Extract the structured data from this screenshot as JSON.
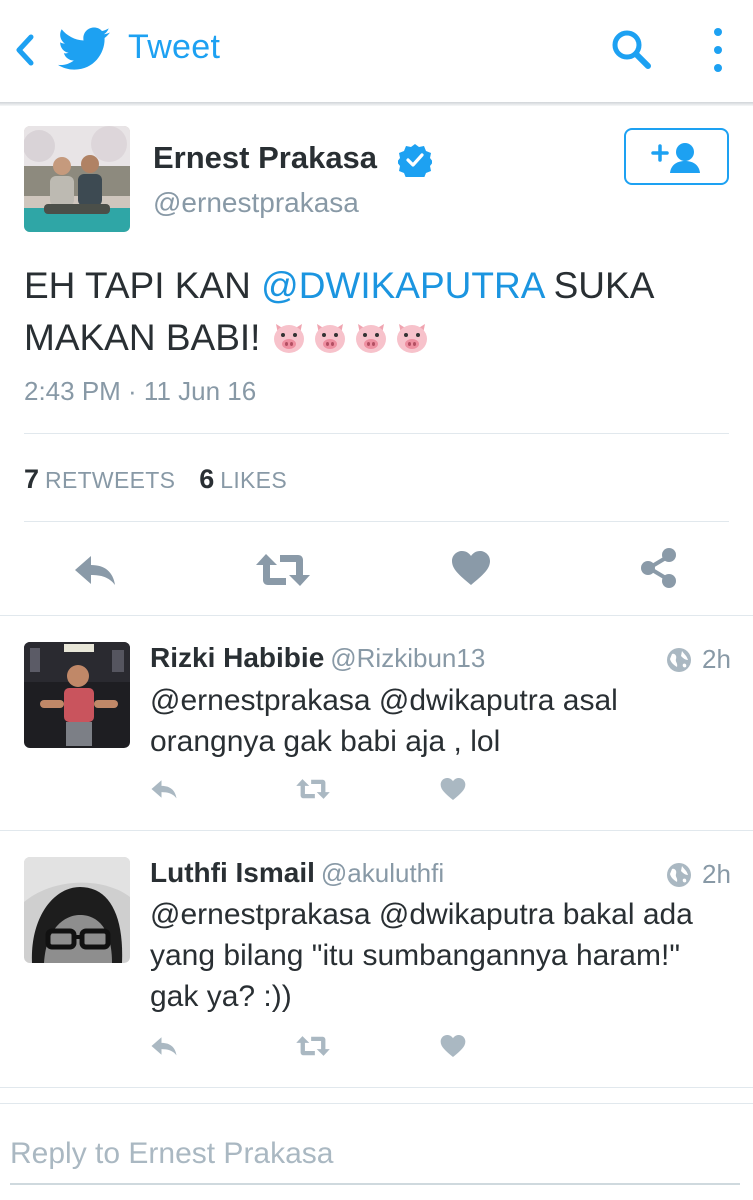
{
  "topbar": {
    "title": "Tweet"
  },
  "tweet": {
    "author_name": "Ernest Prakasa",
    "author_handle": "@ernestprakasa",
    "text_before": "EH TAPI KAN ",
    "mention": "@DWIKAPUTRA",
    "text_after": " SUKA MAKAN BABI! ",
    "emoji": [
      "pig-face",
      "pig-face",
      "pig-face",
      "pig-face"
    ],
    "timestamp": "2:43 PM · 11 Jun 16",
    "retweets_count": "7",
    "retweets_label": "RETWEETS",
    "likes_count": "6",
    "likes_label": "LIKES",
    "verified": true
  },
  "replies": [
    {
      "name": "Rizki Habibie",
      "handle": "@Rizkibun13",
      "time": "2h",
      "text": "@ernestprakasa @dwikaputra asal orangnya gak babi aja , lol"
    },
    {
      "name": "Luthfi Ismail",
      "handle": "@akuluthfi",
      "time": "2h",
      "text": "@ernestprakasa @dwikaputra bakal ada yang bilang \"itu sumbangannya haram!\" gak ya? :))"
    }
  ],
  "reply_box": {
    "placeholder": "Reply to Ernest Prakasa"
  },
  "colors": {
    "accent": "#1da1f2",
    "mention": "#1b95e0",
    "muted": "#8899a6",
    "icon_gray": "#aab8c2",
    "action_gray": "#8a9aa8"
  }
}
